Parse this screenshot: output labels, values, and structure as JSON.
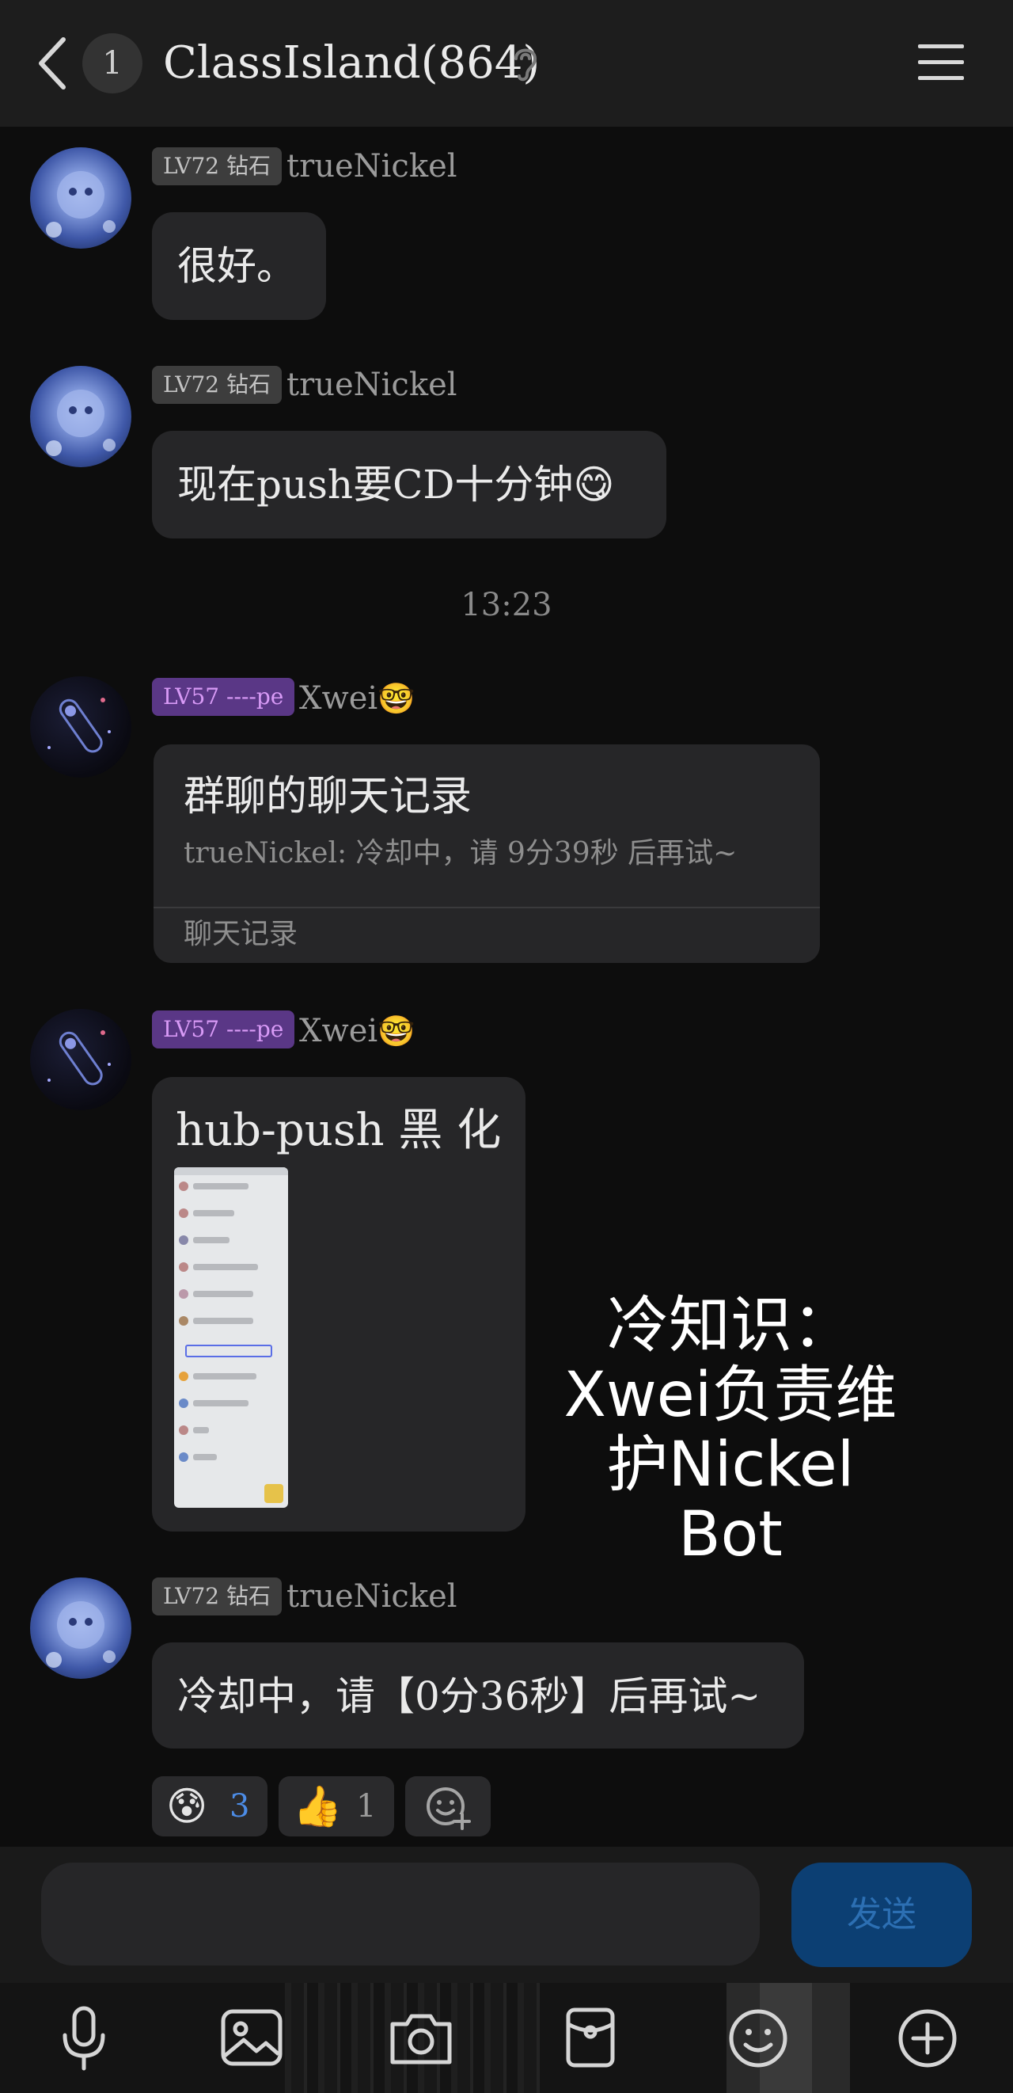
{
  "header": {
    "unread_count": "1",
    "title": "ClassIsland(864)"
  },
  "messages": [
    {
      "level": "LV72 钻石",
      "name": "trueNickel",
      "text": "很好。"
    },
    {
      "level": "LV72 钻石",
      "name": "trueNickel",
      "text": "现在push要CD十分钟",
      "emoji": "😋"
    },
    {
      "level": "LV57 ----pe",
      "name": "Xwei",
      "name_emoji": "🤓"
    },
    {
      "level": "LV57 ----pe",
      "name": "Xwei",
      "name_emoji": "🤓",
      "caption": "hub-push 黑   化"
    },
    {
      "level": "LV72 钻石",
      "name": "trueNickel",
      "text": "冷却中，请【0分36秒】后再试~"
    }
  ],
  "time_separator": "13:23",
  "forward_card": {
    "title": "群聊的聊天记录",
    "preview": "trueNickel: 冷却中，请 9分39秒 后再试~",
    "footer": "聊天记录"
  },
  "overlay_note": "冷知识：Xwei负责维护Nickel Bot",
  "reactions": [
    {
      "emoji": "😰",
      "count": "3",
      "count_color": "#4c8ce6"
    },
    {
      "emoji": "👍",
      "count": "1",
      "count_color": "#9a9a9a"
    }
  ],
  "input": {
    "send_label": "发送"
  },
  "toolbar": [
    "microphone-icon",
    "image-icon",
    "camera-icon",
    "red-packet-icon",
    "emoji-icon",
    "plus-icon"
  ]
}
